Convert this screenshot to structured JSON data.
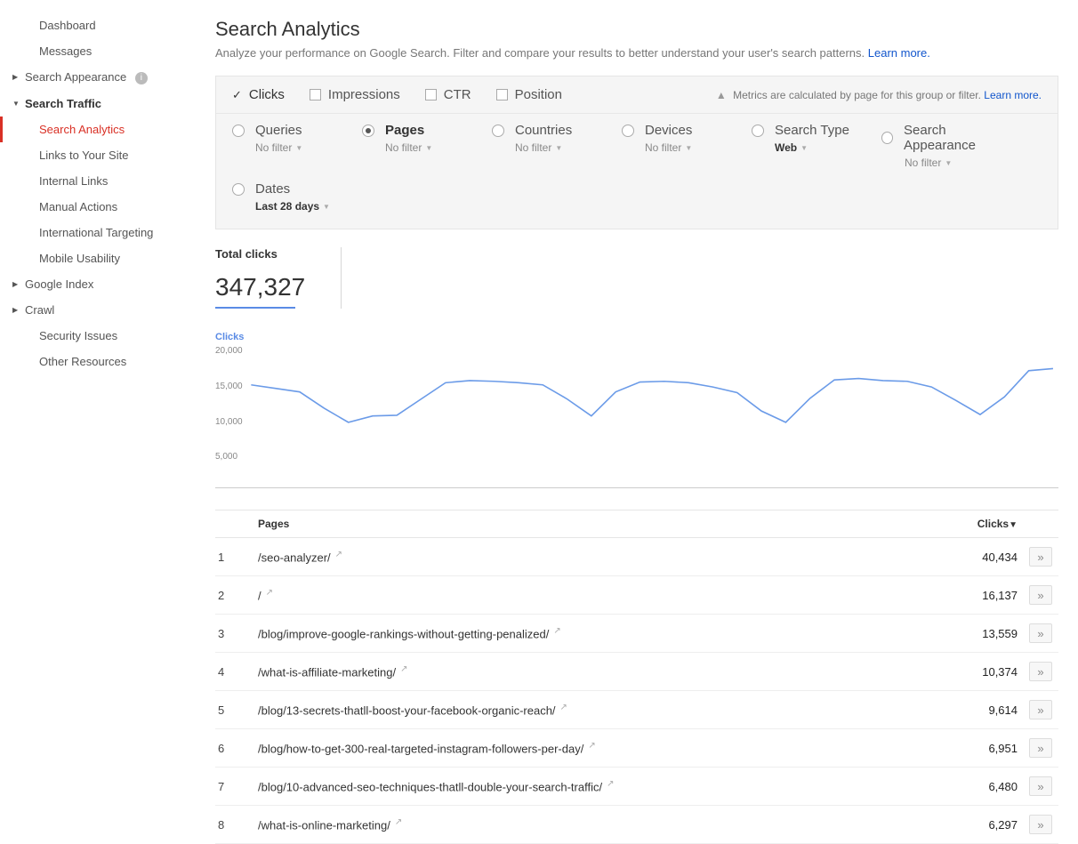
{
  "sidebar": {
    "dashboard": "Dashboard",
    "messages": "Messages",
    "search_appearance": "Search Appearance",
    "search_traffic": "Search Traffic",
    "search_traffic_items": {
      "search_analytics": "Search Analytics",
      "links_to_site": "Links to Your Site",
      "internal_links": "Internal Links",
      "manual_actions": "Manual Actions",
      "international_targeting": "International Targeting",
      "mobile_usability": "Mobile Usability"
    },
    "google_index": "Google Index",
    "crawl": "Crawl",
    "security_issues": "Security Issues",
    "other_resources": "Other Resources"
  },
  "header": {
    "title": "Search Analytics",
    "subtitle": "Analyze your performance on Google Search. Filter and compare your results to better understand your user's search patterns.",
    "learn_more": "Learn more."
  },
  "metrics": {
    "clicks": "Clicks",
    "impressions": "Impressions",
    "ctr": "CTR",
    "position": "Position",
    "note": "Metrics are calculated by page for this group or filter.",
    "note_link": "Learn more."
  },
  "dimensions": {
    "queries": {
      "label": "Queries",
      "sub": "No filter"
    },
    "pages": {
      "label": "Pages",
      "sub": "No filter"
    },
    "countries": {
      "label": "Countries",
      "sub": "No filter"
    },
    "devices": {
      "label": "Devices",
      "sub": "No filter"
    },
    "search_type": {
      "label": "Search Type",
      "sub": "Web"
    },
    "search_appearance": {
      "label": "Search Appearance",
      "sub": "No filter"
    },
    "dates": {
      "label": "Dates",
      "sub": "Last 28 days"
    }
  },
  "total": {
    "label": "Total clicks",
    "value": "347,327"
  },
  "chart_label": "Clicks",
  "chart_data": {
    "type": "line",
    "title": "Clicks",
    "ylabel": "Clicks",
    "ylim": [
      0,
      20000
    ],
    "yticks": [
      "5,000",
      "10,000",
      "15,000",
      "20,000"
    ],
    "x": [
      1,
      2,
      3,
      4,
      5,
      6,
      7,
      8,
      9,
      10,
      11,
      12,
      13,
      14,
      15,
      16,
      17,
      18,
      19,
      20,
      21,
      22,
      23,
      24,
      25,
      26,
      27,
      28
    ],
    "values": [
      14500,
      14000,
      13500,
      11200,
      9200,
      10100,
      10200,
      12500,
      14800,
      15100,
      15000,
      14800,
      14500,
      12500,
      10100,
      13500,
      14900,
      15000,
      14800,
      14200,
      13400,
      10800,
      9200,
      12600,
      15200,
      15400,
      15100,
      15000
    ]
  },
  "chart_overflow_values": [
    14200,
    12300,
    10300,
    12800,
    16500,
    16800
  ],
  "table": {
    "head_pages": "Pages",
    "head_clicks": "Clicks",
    "rows": [
      {
        "n": "1",
        "page": "/seo-analyzer/",
        "clicks": "40,434"
      },
      {
        "n": "2",
        "page": "/",
        "clicks": "16,137"
      },
      {
        "n": "3",
        "page": "/blog/improve-google-rankings-without-getting-penalized/",
        "clicks": "13,559"
      },
      {
        "n": "4",
        "page": "/what-is-affiliate-marketing/",
        "clicks": "10,374"
      },
      {
        "n": "5",
        "page": "/blog/13-secrets-thatll-boost-your-facebook-organic-reach/",
        "clicks": "9,614"
      },
      {
        "n": "6",
        "page": "/blog/how-to-get-300-real-targeted-instagram-followers-per-day/",
        "clicks": "6,951"
      },
      {
        "n": "7",
        "page": "/blog/10-advanced-seo-techniques-thatll-double-your-search-traffic/",
        "clicks": "6,480"
      },
      {
        "n": "8",
        "page": "/what-is-online-marketing/",
        "clicks": "6,297"
      }
    ]
  }
}
